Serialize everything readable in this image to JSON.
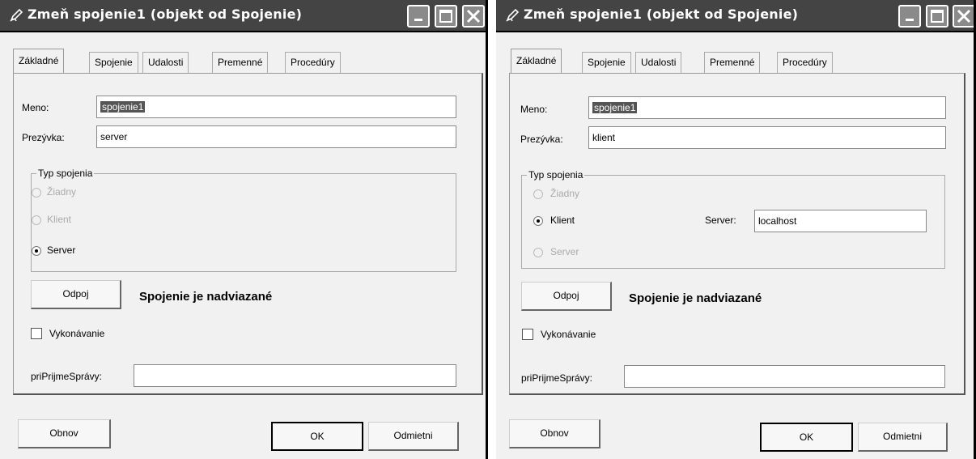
{
  "windows": [
    {
      "title": "Zmeň spojenie1 (objekt od Spojenie)",
      "tabs": [
        "Základné",
        "Spojenie",
        "Udalosti",
        "Premenné",
        "Procedúry"
      ],
      "meno_label": "Meno:",
      "meno_value": "spojenie1",
      "prezyvka_label": "Prezývka:",
      "prezyvka_value": "server",
      "typ_spojenia_label": "Typ spojenia",
      "radio_ziadny": "Žiadny",
      "radio_klient": "Klient",
      "radio_server": "Server",
      "selected_radio": "Server",
      "odpoj_label": "Odpoj",
      "status_text": "Spojenie je nadviazané",
      "vykonavanie_label": "Vykonávanie",
      "vykonavanie_checked": false,
      "priprijme_label": "priPrijmeSprávy:",
      "priprijme_value": "",
      "obnov_label": "Obnov",
      "ok_label": "OK",
      "odmietni_label": "Odmietni"
    },
    {
      "title": "Zmeň spojenie1 (objekt od Spojenie)",
      "tabs": [
        "Základné",
        "Spojenie",
        "Udalosti",
        "Premenné",
        "Procedúry"
      ],
      "meno_label": "Meno:",
      "meno_value": "spojenie1",
      "prezyvka_label": "Prezývka:",
      "prezyvka_value": "klient",
      "typ_spojenia_label": "Typ spojenia",
      "radio_ziadny": "Žiadny",
      "radio_klient": "Klient",
      "radio_server": "Server",
      "selected_radio": "Klient",
      "server_label": "Server:",
      "server_value": "localhost",
      "odpoj_label": "Odpoj",
      "status_text": "Spojenie je nadviazané",
      "vykonavanie_label": "Vykonávanie",
      "vykonavanie_checked": false,
      "priprijme_label": "priPrijmeSprávy:",
      "priprijme_value": "",
      "obnov_label": "Obnov",
      "ok_label": "OK",
      "odmietni_label": "Odmietni"
    }
  ],
  "icons": {
    "window_icon": "pen-icon",
    "minimize": "minimize-icon",
    "maximize": "maximize-icon",
    "close": "close-icon"
  }
}
